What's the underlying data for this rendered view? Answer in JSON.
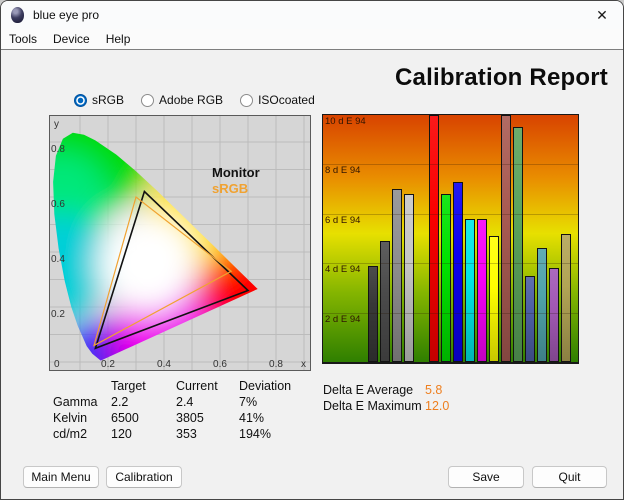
{
  "window": {
    "title": "blue eye pro",
    "icon": "eye",
    "close_glyph": "✕"
  },
  "menu": {
    "items": [
      "Tools",
      "Device",
      "Help"
    ]
  },
  "report": {
    "title": "Calibration Report"
  },
  "profiles": {
    "options": [
      {
        "label": "sRGB",
        "selected": true
      },
      {
        "label": "Adobe RGB",
        "selected": false
      },
      {
        "label": "ISOcoated",
        "selected": false
      }
    ]
  },
  "colors": {
    "accent_orange": "#ee7f1f",
    "legend_orange": "#f0a231",
    "radio_blue": "#0067c0"
  },
  "chart_data": [
    {
      "type": "area",
      "name": "cie-1931-chromaticity",
      "xlabel": "x",
      "ylabel": "y",
      "xlim": [
        0,
        0.9
      ],
      "ylim": [
        0,
        0.9
      ],
      "xticks": [
        "0",
        "0.2",
        "0.4",
        "0.6",
        "0.8"
      ],
      "yticks": [
        "0.2",
        "0.4",
        "0.6",
        "0.8"
      ],
      "grid": true,
      "series": [
        {
          "name": "Monitor",
          "color": "#111111",
          "points": [
            [
              0.7,
              0.26
            ],
            [
              0.33,
              0.62
            ],
            [
              0.155,
              0.05
            ]
          ]
        },
        {
          "name": "sRGB",
          "color": "#f0a231",
          "points": [
            [
              0.64,
              0.33
            ],
            [
              0.3,
              0.6
            ],
            [
              0.15,
              0.06
            ]
          ]
        }
      ],
      "legend_position": "upper-right"
    },
    {
      "type": "bar",
      "name": "delta-e-94-per-patch",
      "ymax": 10,
      "ylabels": [
        "10 d E 94",
        "8 d E 94",
        "6 d E 94",
        "4 d E 94",
        "2 d E 94"
      ],
      "background_scale_colors": [
        "#d84300",
        "#e98c00",
        "#e7e000",
        "#84b500",
        "#2f7f00"
      ],
      "groups": [
        {
          "name": "gray-levels",
          "gap_before": 0,
          "bars": [
            {
              "name": "black",
              "color": "#383838",
              "value": 3.9
            },
            {
              "name": "dark-gray",
              "color": "#4c4c4c",
              "value": 4.9
            },
            {
              "name": "gray",
              "color": "#8f8f8f",
              "value": 7.0
            },
            {
              "name": "light-gray",
              "color": "#c6c6c6",
              "value": 6.8
            }
          ]
        },
        {
          "name": "rgbcmy",
          "gap_before": 13,
          "bars": [
            {
              "name": "red",
              "color": "#fa0000",
              "value": 12.0
            },
            {
              "name": "green",
              "color": "#00e300",
              "value": 6.8
            },
            {
              "name": "blue",
              "color": "#0b00f0",
              "value": 7.3
            },
            {
              "name": "cyan",
              "color": "#00e8e8",
              "value": 5.8
            },
            {
              "name": "magenta",
              "color": "#f800f8",
              "value": 5.8
            },
            {
              "name": "yellow",
              "color": "#ffff00",
              "value": 5.1
            }
          ]
        },
        {
          "name": "mixed-tones",
          "gap_before": 0,
          "bars": [
            {
              "name": "brick",
              "color": "#a85a52",
              "value": 10.4
            },
            {
              "name": "mid-green",
              "color": "#5ba35b",
              "value": 9.5
            },
            {
              "name": "slate-blue",
              "color": "#4d5fa6",
              "value": 3.5
            },
            {
              "name": "teal",
              "color": "#4fa3ab",
              "value": 4.6
            },
            {
              "name": "violet",
              "color": "#a259b5",
              "value": 3.8
            },
            {
              "name": "olive",
              "color": "#b2a455",
              "value": 5.2
            }
          ]
        }
      ]
    }
  ],
  "table": {
    "headers": [
      "",
      "Target",
      "Current",
      "Deviation"
    ],
    "rows": [
      {
        "label": "Gamma",
        "target": "2.2",
        "current": "2.4",
        "deviation": "7%"
      },
      {
        "label": "Kelvin",
        "target": "6500",
        "current": "3805",
        "deviation": "41%"
      },
      {
        "label": "cd/m2",
        "target": "120",
        "current": "353",
        "deviation": "194%"
      }
    ]
  },
  "delta": {
    "rows": [
      {
        "label": "Delta E Average",
        "value": "5.8"
      },
      {
        "label": "Delta E Maximum",
        "value": "12.0"
      }
    ]
  },
  "buttons": {
    "main_menu": "Main Menu",
    "calibration": "Calibration",
    "save": "Save",
    "quit": "Quit"
  }
}
